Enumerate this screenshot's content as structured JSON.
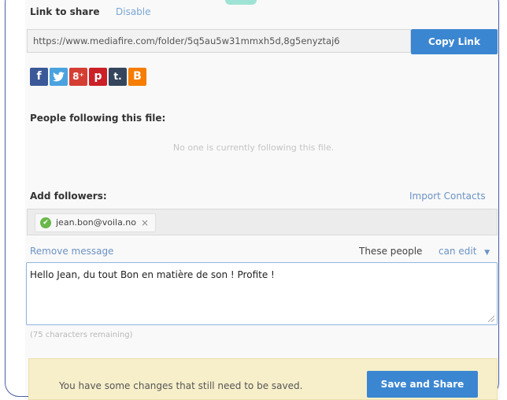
{
  "share": {
    "title": "Link to share",
    "disable_label": "Disable",
    "url": "https://www.mediafire.com/folder/5q5au5w31mmxh5d,8g5enyztaj6",
    "copy_label": "Copy Link"
  },
  "social_buttons": [
    {
      "name": "facebook",
      "glyph": "f",
      "color": "#3b5998"
    },
    {
      "name": "twitter",
      "glyph": "t",
      "color": "#4aa3df"
    },
    {
      "name": "google-plus",
      "glyph": "8⁺",
      "color": "#d53f33"
    },
    {
      "name": "pinterest",
      "glyph": "p",
      "color": "#cb2027"
    },
    {
      "name": "tumblr",
      "glyph": "t.",
      "color": "#35465c"
    },
    {
      "name": "blogger",
      "glyph": "B",
      "color": "#f57d00"
    }
  ],
  "followers": {
    "title": "People following this file:",
    "empty_text": "No one is currently following this file."
  },
  "add": {
    "title": "Add followers:",
    "import_label": "Import Contacts",
    "tag_email": "jean.bon@voila.no",
    "tag_remove": "×"
  },
  "message": {
    "remove_label": "Remove message",
    "permission_text": "These people",
    "permission_value": "can edit",
    "text": "Hello Jean, du tout Bon en matière de son ! Profite !",
    "remaining": "(75 characters remaining)"
  },
  "save": {
    "notice": "You have some changes that still need to be saved.",
    "button_label": "Save and Share"
  }
}
